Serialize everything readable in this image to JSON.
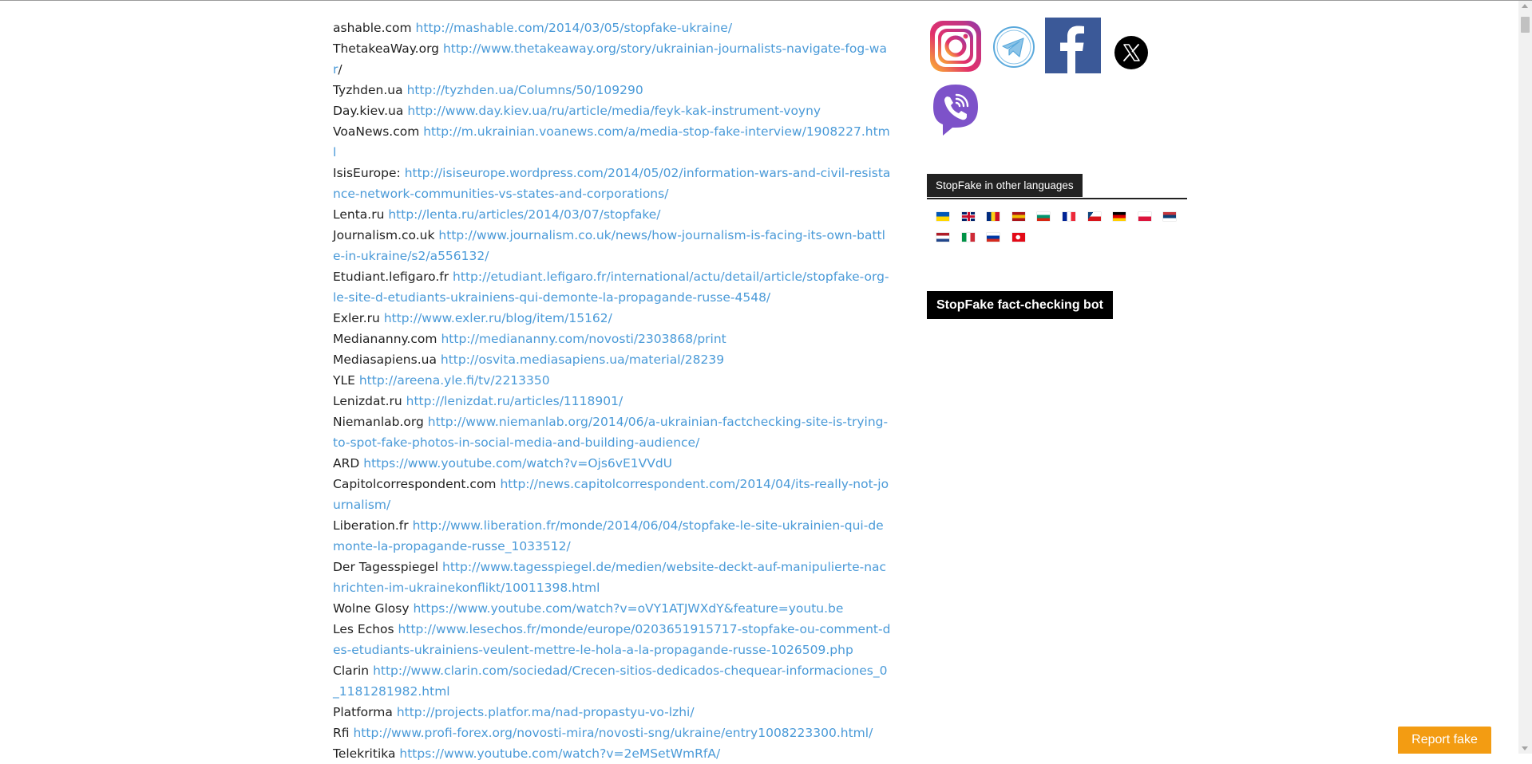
{
  "article": {
    "sources": [
      {
        "name": "ashable.com",
        "url": "http://mashable.com/2014/03/05/stopfake-ukraine/",
        "suffix": ""
      },
      {
        "name": "ThetakeaWay.org",
        "url": "http://www.thetakeaway.org/story/ukrainian-journalists-navigate-fog-war",
        "suffix": "/"
      },
      {
        "name": "Tyzhden.ua",
        "url": "http://tyzhden.ua/Columns/50/109290",
        "suffix": ""
      },
      {
        "name": "Day.kiev.ua",
        "url": "http://www.day.kiev.ua/ru/article/media/feyk-kak-instrument-voyny",
        "suffix": ""
      },
      {
        "name": "VoaNews.com",
        "url": "http://m.ukrainian.voanews.com/a/media-stop-fake-interview/1908227.html",
        "suffix": ""
      },
      {
        "name": "IsisEurope:",
        "url": "http://isiseurope.wordpress.com/2014/05/02/information-wars-and-civil-resistance-network-communities-vs-states-and-corporations/",
        "suffix": ""
      },
      {
        "name": "Lenta.ru",
        "url": "http://lenta.ru/articles/2014/03/07/stopfake/",
        "suffix": ""
      },
      {
        "name": "Journalism.co.uk",
        "url": "http://www.journalism.co.uk/news/how-journalism-is-facing-its-own-battle-in-ukraine/s2/a556132/",
        "suffix": ""
      },
      {
        "name": "Etudiant.lefigaro.fr",
        "url": "http://etudiant.lefigaro.fr/international/actu/detail/article/stopfake-org-le-site-d-etudiants-ukrainiens-qui-demonte-la-propagande-russe-4548/",
        "suffix": ""
      },
      {
        "name": "Exler.ru",
        "url": "http://www.exler.ru/blog/item/15162/",
        "suffix": ""
      },
      {
        "name": "Mediananny.com",
        "url": "http://mediananny.com/novosti/2303868/print",
        "suffix": ""
      },
      {
        "name": "Mediasapiens.ua",
        "url": "http://osvita.mediasapiens.ua/material/28239",
        "suffix": ""
      },
      {
        "name": "YLE",
        "url": "http://areena.yle.fi/tv/2213350",
        "suffix": ""
      },
      {
        "name": "Lenizdat.ru",
        "url": "http://lenizdat.ru/articles/1118901/",
        "suffix": ""
      },
      {
        "name": "Niemanlab.org",
        "url": "http://www.niemanlab.org/2014/06/a-ukrainian-factchecking-site-is-trying-to-spot-fake-photos-in-social-media-and-building-audience/",
        "suffix": ""
      },
      {
        "name": "ARD",
        "url": "https://www.youtube.com/watch?v=Ojs6vE1VVdU",
        "suffix": ""
      },
      {
        "name": "Capitolcorrespondent.com",
        "url": "http://news.capitolcorrespondent.com/2014/04/its-really-not-journalism/",
        "suffix": ""
      },
      {
        "name": "Liberation.fr",
        "url": "http://www.liberation.fr/monde/2014/06/04/stopfake-le-site-ukrainien-qui-demonte-la-propagande-russe_1033512/",
        "suffix": ""
      },
      {
        "name": "Der Tagesspiegel",
        "url": "http://www.tagesspiegel.de/medien/website-deckt-auf-manipulierte-nachrichten-im-ukrainekonflikt/10011398.html",
        "suffix": ""
      },
      {
        "name": "Wolne Glosy",
        "url": "https://www.youtube.com/watch?v=oVY1ATJWXdY&feature=youtu.be",
        "suffix": ""
      },
      {
        "name": "Les Echos",
        "url": "http://www.lesechos.fr/monde/europe/0203651915717-stopfake-ou-comment-des-etudiants-ukrainiens-veulent-mettre-le-hola-a-la-propagande-russe-1026509.php",
        "suffix": ""
      },
      {
        "name": "Clarin",
        "url": "http://www.clarin.com/sociedad/Crecen-sitios-dedicados-chequear-informaciones_0_1181281982.html",
        "suffix": ""
      },
      {
        "name": "Platforma",
        "url": "http://projects.platfor.ma/nad-propastyu-vo-lzhi/",
        "suffix": ""
      },
      {
        "name": "Rfi",
        "url": "http://www.profi-forex.org/novosti-mira/novosti-sng/ukraine/entry1008223300.html/",
        "suffix": ""
      },
      {
        "name": "Telekritika",
        "url": "https://www.youtube.com/watch?v=2eMSetWmRfA/",
        "suffix": ""
      }
    ]
  },
  "sidebar": {
    "social": [
      {
        "name": "instagram-icon"
      },
      {
        "name": "telegram-icon"
      },
      {
        "name": "facebook-icon"
      },
      {
        "name": "x-icon"
      },
      {
        "name": "viber-icon"
      }
    ],
    "languages_title": "StopFake in other languages",
    "language_flags": [
      {
        "lang": "ukrainian",
        "colors": [
          "#0057b7",
          "#ffd700"
        ]
      },
      {
        "lang": "english",
        "colors": [
          "#012169",
          "#ffffff",
          "#c8102e"
        ]
      },
      {
        "lang": "romanian",
        "colors": [
          "#002b7f",
          "#fcd116",
          "#ce1126"
        ]
      },
      {
        "lang": "spanish",
        "colors": [
          "#aa151b",
          "#f1bf00",
          "#aa151b"
        ]
      },
      {
        "lang": "bulgarian",
        "colors": [
          "#ffffff",
          "#00966e",
          "#d62612"
        ]
      },
      {
        "lang": "french",
        "colors": [
          "#002395",
          "#ffffff",
          "#ed2939"
        ]
      },
      {
        "lang": "czech",
        "colors": [
          "#ffffff",
          "#d7141a",
          "#11457e"
        ]
      },
      {
        "lang": "german",
        "colors": [
          "#000000",
          "#dd0000",
          "#ffce00"
        ]
      },
      {
        "lang": "polish",
        "colors": [
          "#ffffff",
          "#dc143c"
        ]
      },
      {
        "lang": "serbian",
        "colors": [
          "#c6363c",
          "#0c4076",
          "#ffffff"
        ]
      },
      {
        "lang": "dutch",
        "colors": [
          "#ae1c28",
          "#ffffff",
          "#21468b"
        ]
      },
      {
        "lang": "italian",
        "colors": [
          "#009246",
          "#ffffff",
          "#ce2b37"
        ]
      },
      {
        "lang": "russian",
        "colors": [
          "#ffffff",
          "#0039a6",
          "#d52b1e"
        ]
      },
      {
        "lang": "turkish",
        "colors": [
          "#e30a17",
          "#ffffff"
        ]
      }
    ],
    "bot_label": "StopFake fact-checking bot"
  },
  "report_button": {
    "label": "Report fake"
  },
  "colors": {
    "link": "#4a9ad8",
    "text": "#222222",
    "widget_bg": "#222222",
    "report_button": "#f39c12"
  }
}
